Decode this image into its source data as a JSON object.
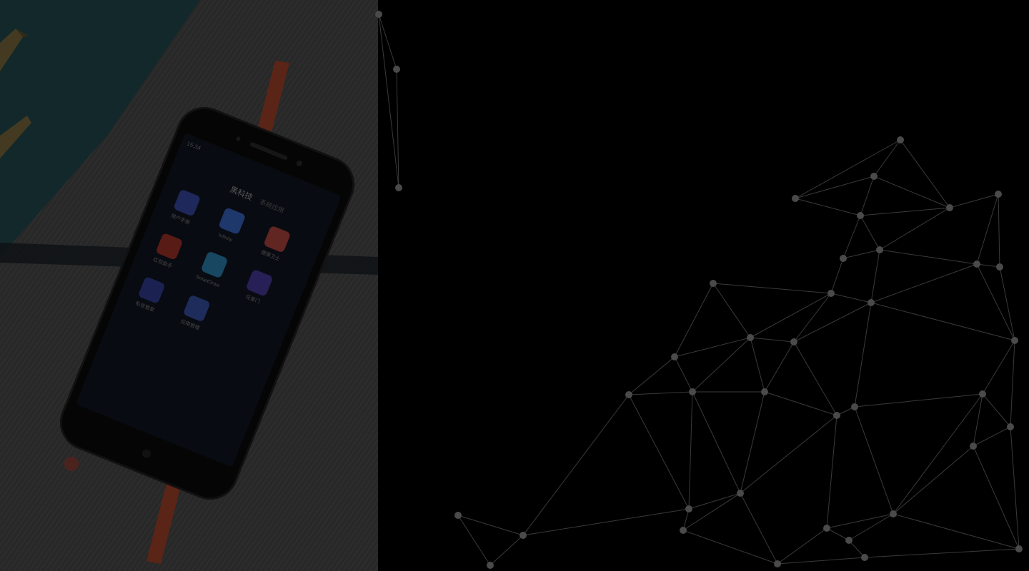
{
  "hero": {
    "image_description_none": "",
    "phone": {
      "status_time": "15:34",
      "app_title": "黑科技",
      "app_tab2": "系统应用",
      "app_icons": [
        {
          "label": "用户手册",
          "color": "#3a4fb0"
        },
        {
          "label": "Infinity",
          "color": "#3b6fd6"
        },
        {
          "label": "健康卫士",
          "color": "#c9473a"
        },
        {
          "label": "红包助手",
          "color": "#b83220"
        },
        {
          "label": "SmartDraw",
          "color": "#2c8fbf"
        },
        {
          "label": "任意门",
          "color": "#4a3ca8"
        },
        {
          "label": "私信管家",
          "color": "#3340a0"
        },
        {
          "label": "应用管理",
          "color": "#3a55b5"
        }
      ]
    },
    "colors": {
      "overlay": "#000000",
      "network_line": "#3a3a3a",
      "network_node": "#4a4a4a"
    }
  }
}
